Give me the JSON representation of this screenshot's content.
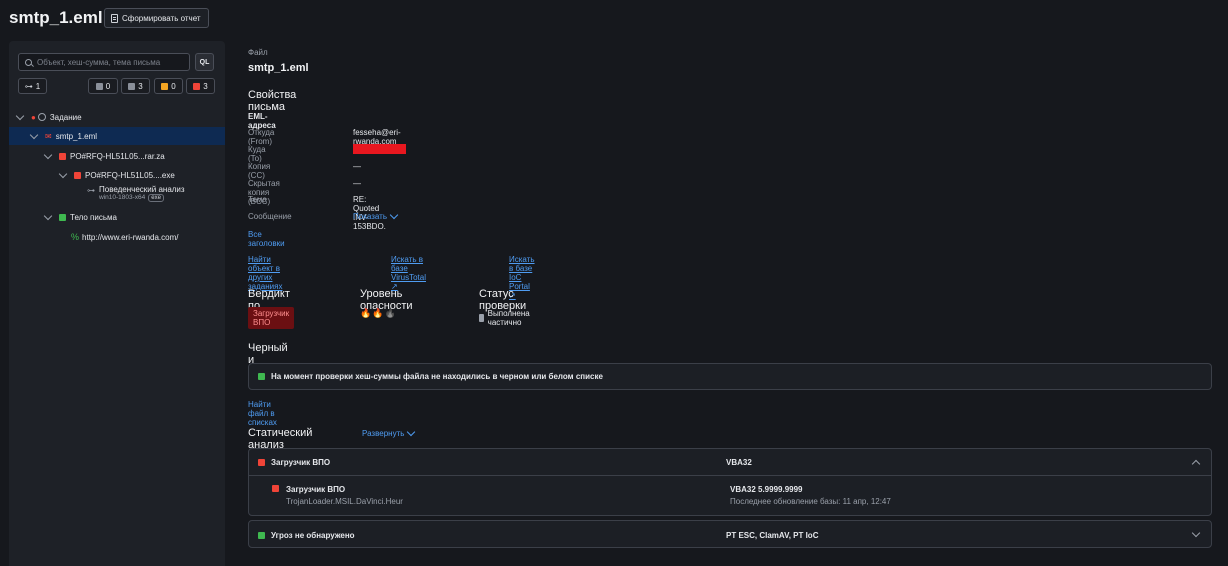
{
  "header": {
    "title": "smtp_1.eml",
    "report_button": "Сформировать отчет"
  },
  "sidebar": {
    "search_placeholder": "Объект, хеш-сумма, тема письма",
    "ql_label": "QL",
    "counters": [
      {
        "value": "1",
        "color": "#cfd2d8"
      },
      {
        "value": "0",
        "color": "#8a8f99"
      },
      {
        "value": "3",
        "color": "#8a8f99"
      },
      {
        "value": "0",
        "color": "#f5a623"
      },
      {
        "value": "3",
        "color": "#f04438"
      }
    ],
    "tree": {
      "task": "Задание",
      "email": "smtp_1.eml",
      "archive": "PO#RFQ-HL51L05...rar.za",
      "executable": "PO#RFQ-HL51L05....exe",
      "behavior": "Поведенческий анализ",
      "behavior_env": "win10-1803-x64",
      "behavior_badge": "exe",
      "body": "Тело письма",
      "url": "http://www.eri-rwanda.com/"
    }
  },
  "main": {
    "file_label": "Файл",
    "file_name": "smtp_1.eml",
    "props_title": "Свойства письма",
    "eml_title": "EML-адреса",
    "fields": [
      {
        "label": "Откуда (From)",
        "value": "fesseha@eri-rwanda.com"
      },
      {
        "label": "Куда (To)",
        "value": ""
      },
      {
        "label": "Копия (CC)",
        "value": "—"
      },
      {
        "label": "Скрытая копия (BCC)",
        "value": "—"
      },
      {
        "label": "Тема",
        "value": "RE: Quoted INV-153BDO."
      },
      {
        "label": "Сообщение",
        "value": "Показать"
      }
    ],
    "all_headers": "Все заголовки",
    "links": [
      "Найти объект в других заданиях",
      "Искать в базе VirusTotal ↗",
      "Искать в базе IoC Portal ↗"
    ],
    "verdict_title": "Вердикт по файлу",
    "verdict_value": "Загрузчик ВПО",
    "danger_title": "Уровень опасности",
    "danger_level": 2,
    "danger_max": 3,
    "status_title": "Статус проверки",
    "status_value": "Выполнена частично",
    "lists_title": "Черный и белый списки",
    "lists_message": "На момент проверки хеш-суммы файла не находились в черном или белом списке",
    "lists_link": "Найти файл в списках",
    "static_title": "Статический анализ",
    "static_expand": "Развернуть",
    "static_rows": {
      "r1_name": "Загрузчик ВПО",
      "r1_engine": "VBA32",
      "d_name": "Загрузчик ВПО",
      "d_sig": "TrojanLoader.MSIL.DaVinci.Heur",
      "d_engine": "VBA32 5.9999.9999",
      "d_update": "Последнее обновление базы: 11 апр, 12:47",
      "r2_name": "Угроз не обнаружено",
      "r2_engines": "PT ESC, ClamAV, PT IoC"
    },
    "colors": {
      "red": "#f04438",
      "green": "#3fb950",
      "link": "#4f9cf2"
    }
  }
}
